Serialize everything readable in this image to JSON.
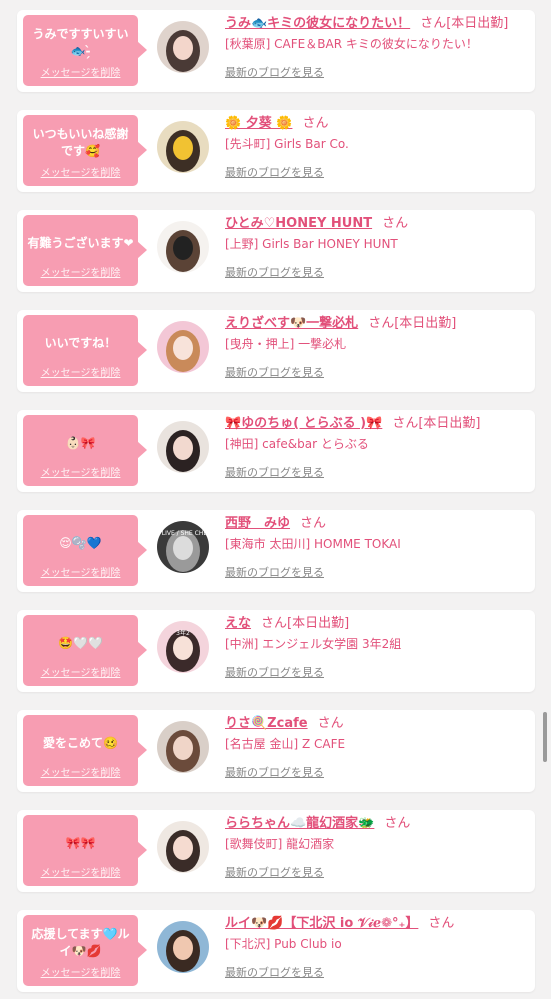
{
  "delete_label": "メッセージを削除",
  "blog_label": "最新のブログを見る",
  "colors": {
    "accent_pink": "#e2507a",
    "bubble_pink": "#f79db2",
    "background": "#f3f2f2"
  },
  "items": [
    {
      "message": "うみですすいすい🐟-̗̀ ",
      "name": "うみ🐟キミの彼女になりたい！",
      "san": "さん",
      "shift": "[本日出勤]",
      "shop": "[秋葉原] CAFE＆BAR キミの彼女になりたい！",
      "avatar_colors": [
        "#dfd3cc",
        "#4a3a36",
        "#f3d6cb"
      ]
    },
    {
      "message": "いつもいいね感謝です🥰",
      "name": "🌼 夕葵 🌼",
      "san": "さん",
      "shift": "",
      "shop": "[先斗町] Girls Bar Co.",
      "avatar_colors": [
        "#e8dcc0",
        "#3d2f25",
        "#f1c232"
      ]
    },
    {
      "message": "有難うございます❤",
      "name": "ひとみ♡HONEY HUNT",
      "san": "さん",
      "shift": "",
      "shop": "[上野] Girls Bar HONEY HUNT",
      "avatar_colors": [
        "#f5f2ef",
        "#5b4336",
        "#222222"
      ]
    },
    {
      "message": "いいですね！",
      "name": "えりざべす🐶一撃必札",
      "san": "さん",
      "shift": "[本日出勤]",
      "shop": "[曳舟・押上] 一撃必札",
      "avatar_colors": [
        "#f3c7d6",
        "#c98a5a",
        "#f8e3da"
      ]
    },
    {
      "message": "👶🏻🎀",
      "name": "🎀ゆのちゅ( とらぶる )🎀",
      "san": "さん",
      "shift": "[本日出勤]",
      "shop": "[神田] cafe&bar とらぶる",
      "avatar_colors": [
        "#e9e3de",
        "#2b2222",
        "#f2d9cf"
      ]
    },
    {
      "message": "😌🫧💙",
      "name": "西野　みゆ",
      "san": "さん",
      "shift": "",
      "shop": "[東海市 太田川] HOMME TOKAI",
      "avatar_colors": [
        "#3a3a3a",
        "#9a9a9a",
        "#dcdcdc"
      ],
      "avatar_text": "DONT LIVE / SHE CHECKED"
    },
    {
      "message": "🤩🤍🤍",
      "name": "えな",
      "san": "さん",
      "shift": "[本日出勤]",
      "shop": "[中洲] エンジェル女学園 3年2組",
      "avatar_colors": [
        "#f4d4dc",
        "#3b2a2a",
        "#f7e1d8"
      ],
      "avatar_text": "3年2"
    },
    {
      "message": "愛をこめて🥴",
      "name": "りさ🍭Zcafe",
      "san": "さん",
      "shift": "",
      "shop": "[名古屋 金山] Z CAFE",
      "avatar_colors": [
        "#d9cfc8",
        "#6b4b3b",
        "#f0d5c8"
      ]
    },
    {
      "message": "🎀🎀",
      "name": "ららちゃん☁️龍幻酒家🐲",
      "san": "さん",
      "shift": "",
      "shop": "[歌舞伎町] 龍幻酒家",
      "avatar_colors": [
        "#efe8e2",
        "#3a2c28",
        "#f5dbd0"
      ]
    },
    {
      "message": "応援してます🩵ルイ🐶💋",
      "name": "ルイ🐶💋【下北沢 io 𝒱𝒾ℯ❁°₊】",
      "san": "さん",
      "shift": "",
      "shop": "[下北沢] Pub Club io",
      "avatar_colors": [
        "#8fb7d6",
        "#3a2a22",
        "#f0c8b0"
      ]
    }
  ]
}
